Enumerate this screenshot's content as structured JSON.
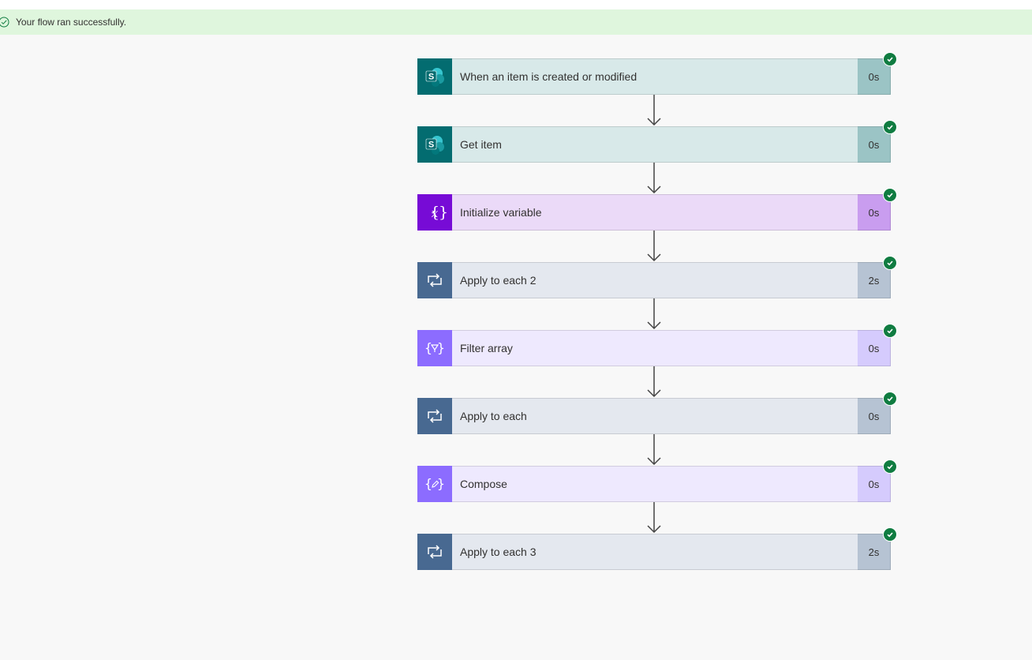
{
  "banner": {
    "message": "Your flow ran successfully.",
    "color": "#dff6dd"
  },
  "steps": [
    {
      "title": "When an item is created or modified",
      "duration": "0s",
      "icon": "sharepoint-icon",
      "status": "succeeded"
    },
    {
      "title": "Get item",
      "duration": "0s",
      "icon": "sharepoint-icon",
      "status": "succeeded"
    },
    {
      "title": "Initialize variable",
      "duration": "0s",
      "icon": "variable-icon",
      "status": "succeeded"
    },
    {
      "title": "Apply to each 2",
      "duration": "2s",
      "icon": "loop-icon",
      "status": "succeeded"
    },
    {
      "title": "Filter array",
      "duration": "0s",
      "icon": "filter-array-icon",
      "status": "succeeded"
    },
    {
      "title": "Apply to each",
      "duration": "0s",
      "icon": "loop-icon",
      "status": "succeeded"
    },
    {
      "title": "Compose",
      "duration": "0s",
      "icon": "compose-icon",
      "status": "succeeded"
    },
    {
      "title": "Apply to each 3",
      "duration": "2s",
      "icon": "loop-icon",
      "status": "succeeded"
    }
  ],
  "colors": {
    "sharepoint": "#036c70",
    "variable": "#770bd6",
    "loop": "#486991",
    "data_operation": "#8c6cff",
    "success": "#107c41"
  }
}
